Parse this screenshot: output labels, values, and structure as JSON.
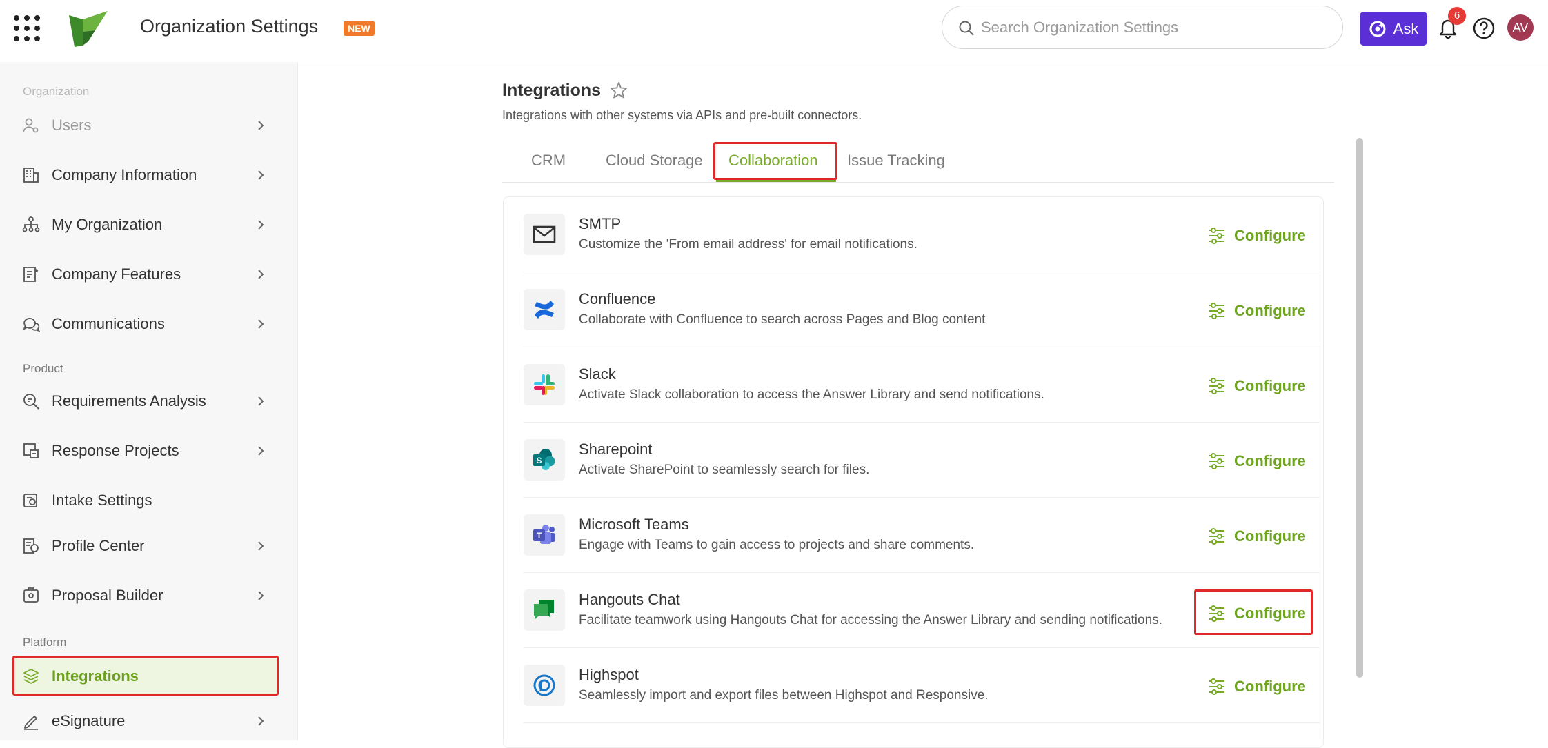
{
  "header": {
    "app_title": "Organization Settings",
    "new_badge": "NEW",
    "search_placeholder": "Search Organization Settings",
    "ask_label": "Ask",
    "notification_count": "6",
    "avatar_initials": "AV"
  },
  "sidebar": {
    "sections": {
      "organization": "Organization",
      "product": "Product",
      "platform": "Platform"
    },
    "items": [
      {
        "label": "Users",
        "icon": "users-gear-icon"
      },
      {
        "label": "Company Information",
        "icon": "building-icon"
      },
      {
        "label": "My Organization",
        "icon": "org-chart-icon"
      },
      {
        "label": "Company Features",
        "icon": "features-list-icon"
      },
      {
        "label": "Communications",
        "icon": "chat-bubbles-icon"
      },
      {
        "label": "Requirements Analysis",
        "icon": "search-analysis-icon"
      },
      {
        "label": "Response Projects",
        "icon": "projects-icon"
      },
      {
        "label": "Intake Settings",
        "icon": "intake-settings-icon"
      },
      {
        "label": "Profile Center",
        "icon": "profile-center-icon"
      },
      {
        "label": "Proposal Builder",
        "icon": "proposal-builder-icon"
      },
      {
        "label": "Integrations",
        "icon": "layers-icon"
      },
      {
        "label": "eSignature",
        "icon": "signature-pen-icon"
      }
    ]
  },
  "main": {
    "title": "Integrations",
    "subtitle": "Integrations with other systems via APIs and pre-built connectors.",
    "tabs": [
      "CRM",
      "Cloud Storage",
      "Collaboration",
      "Issue Tracking"
    ],
    "active_tab": "Collaboration",
    "configure_label": "Configure",
    "integrations": [
      {
        "name": "SMTP",
        "description": "Customize the 'From email address' for email notifications.",
        "icon": "mail-icon"
      },
      {
        "name": "Confluence",
        "description": "Collaborate with Confluence to search across Pages and Blog content",
        "icon": "confluence-icon"
      },
      {
        "name": "Slack",
        "description": "Activate Slack collaboration to access the Answer Library and send notifications.",
        "icon": "slack-icon"
      },
      {
        "name": "Sharepoint",
        "description": "Activate SharePoint to seamlessly search for files.",
        "icon": "sharepoint-icon"
      },
      {
        "name": "Microsoft Teams",
        "description": "Engage with Teams to gain access to projects and share comments.",
        "icon": "teams-icon"
      },
      {
        "name": "Hangouts Chat",
        "description": "Facilitate teamwork using Hangouts Chat for accessing the Answer Library and sending notifications.",
        "icon": "hangouts-chat-icon"
      },
      {
        "name": "Highspot",
        "description": "Seamlessly import and export files between Highspot and Responsive.",
        "icon": "highspot-icon"
      }
    ]
  },
  "colors": {
    "accent_green": "#79ab2a",
    "ask_purple": "#5b2fd6",
    "highlight_red": "#e02a2a",
    "new_badge_orange": "#f07a2a"
  }
}
